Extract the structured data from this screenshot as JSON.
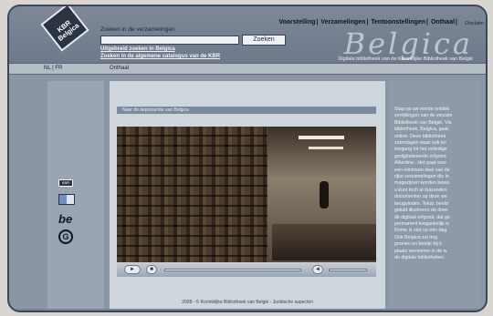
{
  "header": {
    "logo_text": "KBR Belgica",
    "search_label": "Zoeken in de verzamelingen",
    "search_value": "",
    "search_button": "Zoeken",
    "advanced_link": "Uitgebreid zoeken in Belgica",
    "catalog_link": "Zoeken in de algemene catalogus van de KBR",
    "nav": [
      "Voorstelling",
      "Verzamelingen",
      "Tentoonstellingen",
      "Onthaal"
    ],
    "nav_separator": "|",
    "lang_top": "Disclaim",
    "brand": "Belgica",
    "tagline": "Digitale bibliotheek van de Koninklijke Bibliotheek van België"
  },
  "subnav": {
    "languages": "NL | FR",
    "home": "Onthaal"
  },
  "sidebar_left": {
    "icons": [
      "kbr-mini-icon",
      "flag-icon",
      "be-icon",
      "g-icon"
    ],
    "be_label": "be",
    "g_label": "G",
    "kbr_label": "KBR"
  },
  "main": {
    "bar_text": "Naar de depotruimte van Belgica",
    "video": {
      "play": "►",
      "stop": "■",
      "volume": "◄"
    },
    "footer": "2008 - © Koninklijke Bibliotheek van België - Juridische aspecten"
  },
  "sidebar_right": {
    "lines": [
      "Stap op uw eerste ontdek",
      "verrijkingen van de verzam",
      "Bibliotheek van België. Via",
      "bibliotheek, Belgica, gaat",
      "online. Deze bibliotheek",
      "zaterdagen waar ook ter",
      "toegang tot het volledige",
      "gedigitaliseerde erfgoed",
      "Albertina . Het gaat voor",
      "een minimum deel van de",
      "rijke verzamelingen die in",
      "magazijnen worden bewa",
      "u kunt toch al duizenden",
      "documenten op deze we",
      "terugvinden. Tekst, beeld",
      "geluid illustreren de diver",
      "dit digitaal erfgoed, dat ge",
      "permanent toegankelijk is",
      "Rome is niet op één dag",
      "Ook Belgica zal ring",
      "groeien en beetje bij b",
      "plaats veroveren in de w",
      "de digitale bibliotheken."
    ]
  },
  "colors": {
    "header_bg": "#7d8898",
    "content_bg": "#cfd5dc",
    "sidebar_bg": "#9aa5b2"
  }
}
